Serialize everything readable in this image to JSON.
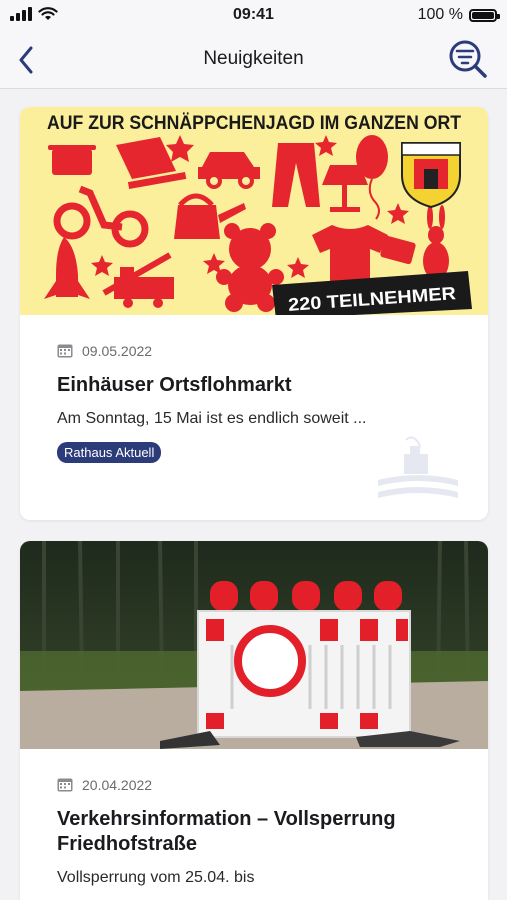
{
  "status_bar": {
    "time": "09:41",
    "battery_text": "100 %",
    "battery_level": 1.0
  },
  "nav": {
    "title": "Neuigkeiten",
    "back_icon": "chevron-left-icon",
    "filter_icon": "filter-search-icon",
    "accent": "#2c3b7a"
  },
  "articles": [
    {
      "image_banner": "AUF ZUR SCHNÄPPCHENJAGD IM GANZEN ORT",
      "image_badge": "220 TEILNEHMER",
      "date": "09.05.2022",
      "title": "Einhäuser Ortsflohmarkt",
      "excerpt": "Am Sonntag, 15 Mai ist es endlich soweit ...",
      "tag": "Rathaus Aktuell"
    },
    {
      "date": "20.04.2022",
      "title": "Verkehrsinformation – Vollsperrung Friedhofstraße",
      "excerpt": "Vollsperrung vom 25.04. bis"
    }
  ],
  "colors": {
    "flyer_bg": "#fbef9b",
    "flyer_red": "#e5262f",
    "tag_bg": "#2c3b7a"
  }
}
